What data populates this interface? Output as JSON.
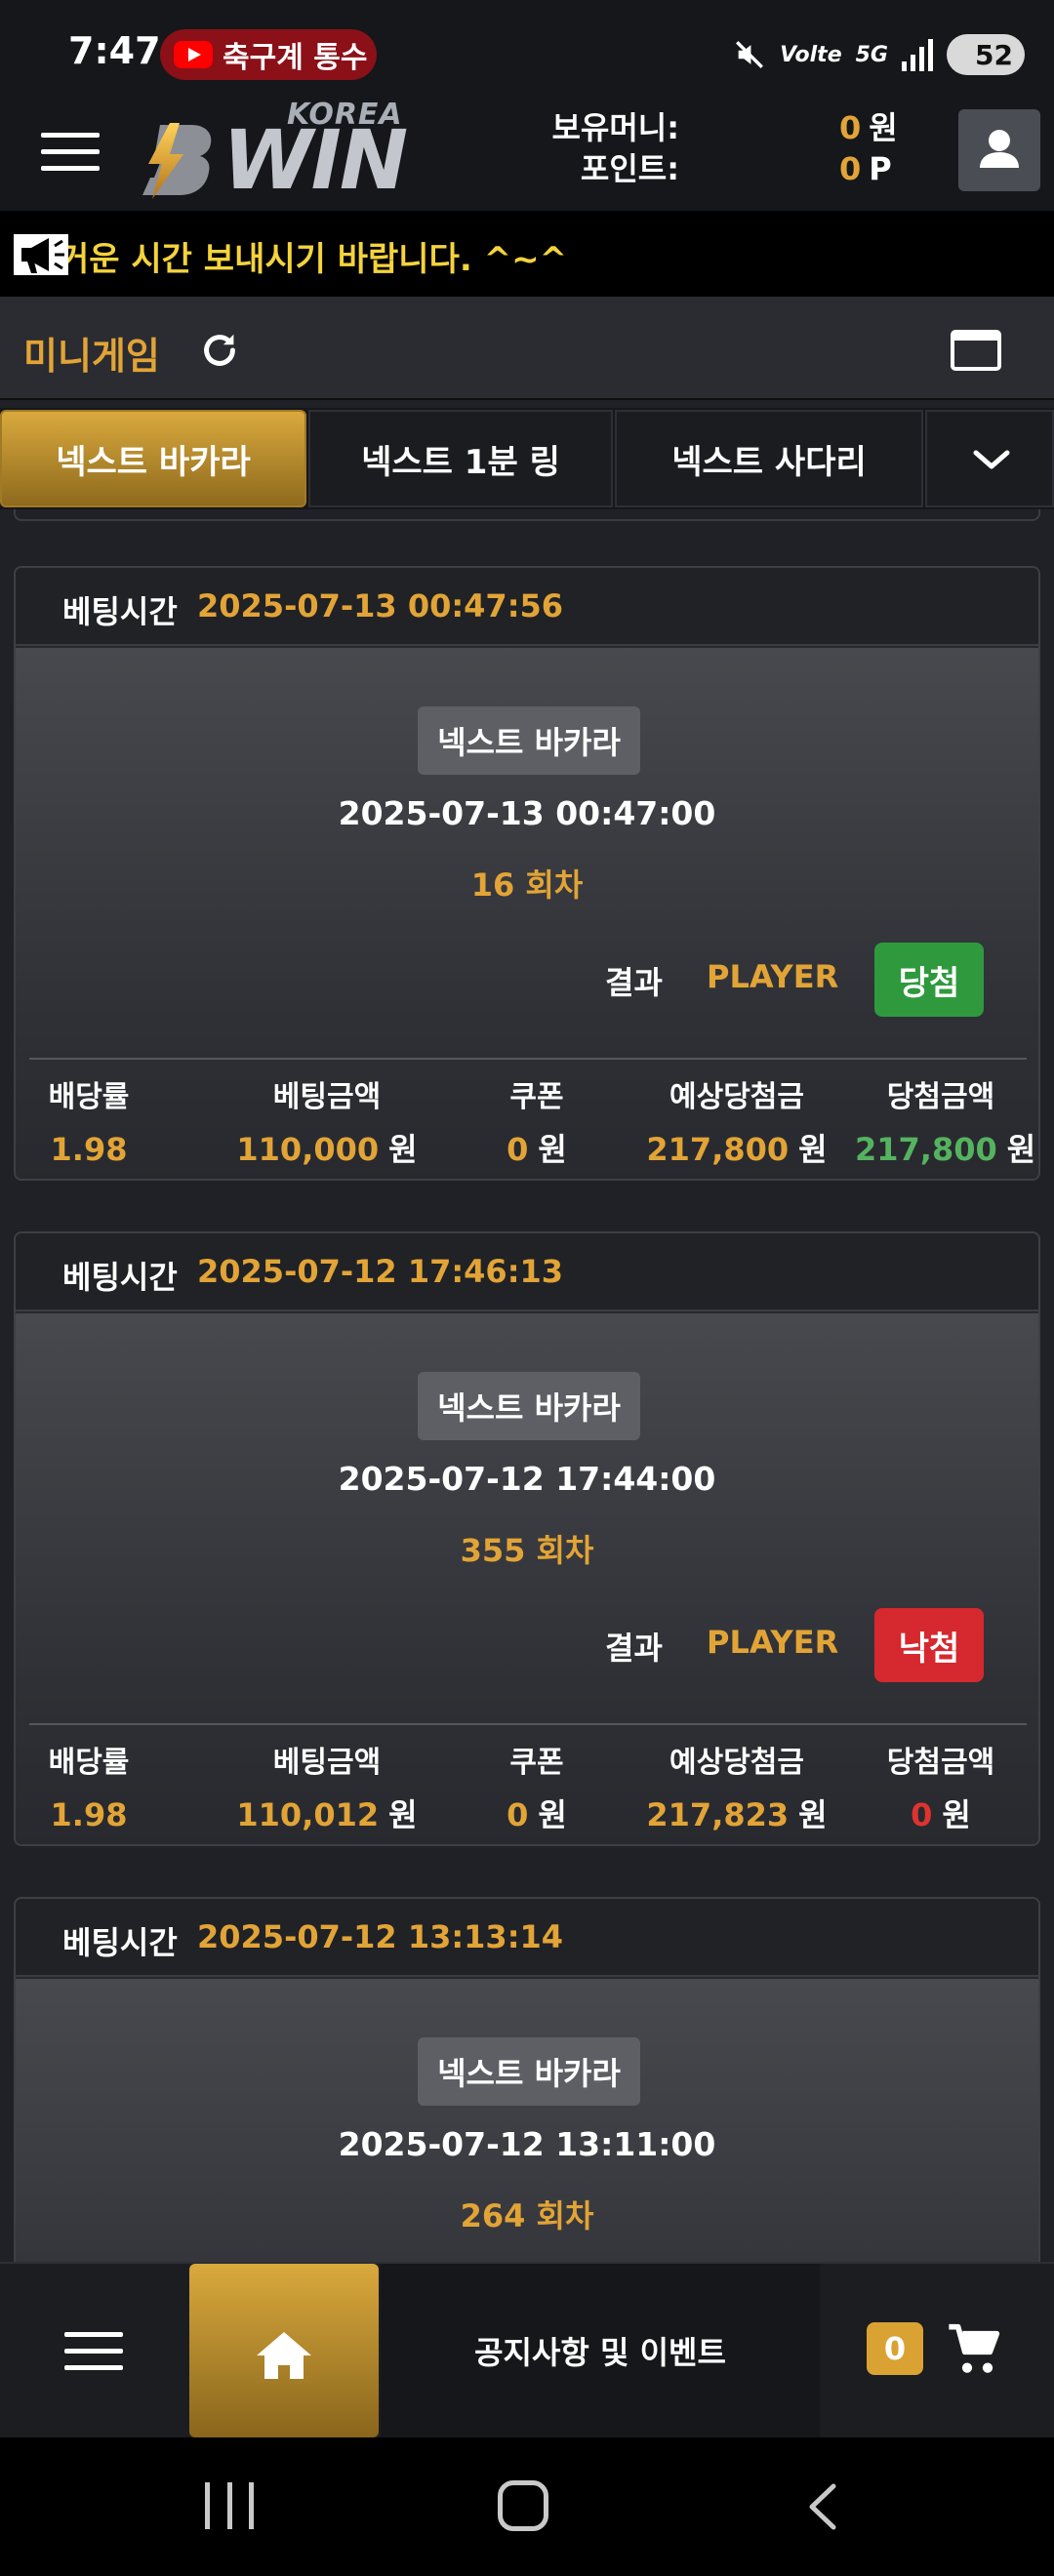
{
  "status_bar": {
    "time": "7:47",
    "notification_text": "축구계 통수",
    "network_label": "5G",
    "volte_label": "Volte",
    "battery": "52"
  },
  "header": {
    "logo_korea": "KOREA",
    "logo_win": "WIN",
    "money_label": "보유머니:",
    "points_label": "포인트:",
    "money_value": "0",
    "money_unit": "원",
    "points_value": "0",
    "points_unit": "P"
  },
  "notice": {
    "text": "거운 시간 보내시기 바랍니다. ^~^"
  },
  "minigame": {
    "title": "미니게임"
  },
  "tabs": [
    {
      "label": "넥스트 바카라",
      "active": true
    },
    {
      "label": "넥스트 1분 링",
      "active": false
    },
    {
      "label": "넥스트 사다리",
      "active": false
    }
  ],
  "bets": [
    {
      "bet_time_label": "베팅시간",
      "bet_time": "2025-07-13 00:47:56",
      "game": "넥스트 바카라",
      "draw_time": "2025-07-13 00:47:00",
      "round": "16 회차",
      "result_label": "결과",
      "result": "PLAYER",
      "status": "당첨",
      "status_type": "win",
      "odds_label": "배당률",
      "odds": "1.98",
      "amount_label": "베팅금액",
      "amount": "110,000",
      "coupon_label": "쿠폰",
      "coupon": "0",
      "expected_label": "예상당첨금",
      "expected": "217,800",
      "payout_label": "당첨금액",
      "payout": "217,800",
      "unit": "원"
    },
    {
      "bet_time_label": "베팅시간",
      "bet_time": "2025-07-12 17:46:13",
      "game": "넥스트 바카라",
      "draw_time": "2025-07-12 17:44:00",
      "round": "355 회차",
      "result_label": "결과",
      "result": "PLAYER",
      "status": "낙첨",
      "status_type": "lose",
      "odds_label": "배당률",
      "odds": "1.98",
      "amount_label": "베팅금액",
      "amount": "110,012",
      "coupon_label": "쿠폰",
      "coupon": "0",
      "expected_label": "예상당첨금",
      "expected": "217,823",
      "payout_label": "당첨금액",
      "payout": "0",
      "unit": "원"
    },
    {
      "bet_time_label": "베팅시간",
      "bet_time": "2025-07-12 13:13:14",
      "game": "넥스트 바카라",
      "draw_time": "2025-07-12 13:11:00",
      "round": "264 회차"
    }
  ],
  "bottom_nav": {
    "notice_label": "공지사항 및 이벤트",
    "cart_count": "0"
  },
  "icons": {
    "menu": "hamburger-icon",
    "user": "user-icon",
    "megaphone": "megaphone-icon",
    "refresh": "refresh-icon",
    "window": "window-icon",
    "chevron": "chevron-down-icon",
    "home": "home-icon",
    "cart": "cart-icon"
  },
  "colors": {
    "accent_gold": "#e2a436",
    "notice_yellow": "#f4d33c",
    "win_green": "#2f9a3d",
    "lose_red": "#d6282f",
    "payout_green": "#55b35f"
  }
}
